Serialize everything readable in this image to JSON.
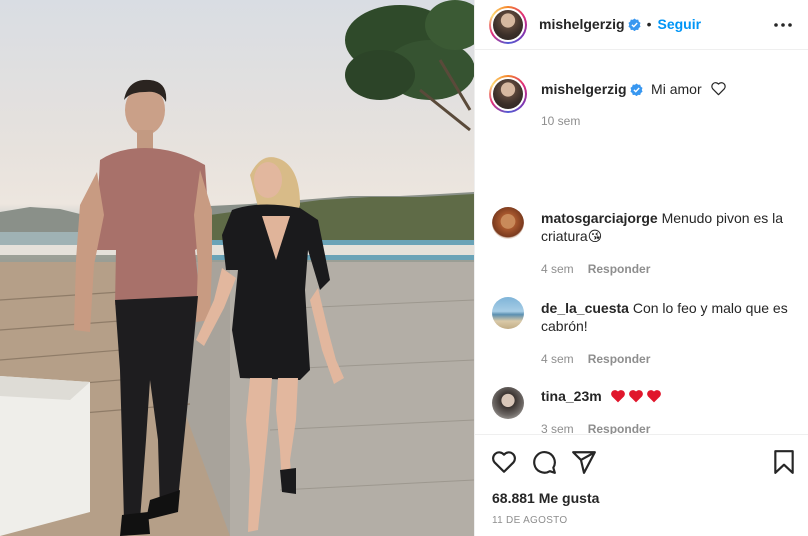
{
  "post": {
    "author": "mishelgerzig",
    "follow_label": "Seguir",
    "separator": "•",
    "caption": "Mi amor",
    "caption_age": "10 sem",
    "likes": "68.881 Me gusta",
    "date": "11 de agosto"
  },
  "comments": [
    {
      "user": "matosgarciajorge",
      "text": "Menudo pivon es la criatura😘",
      "age": "4 sem",
      "reply": "Responder"
    },
    {
      "user": "de_la_cuesta",
      "text": "Con lo feo y malo que es cabrón!",
      "age": "4 sem",
      "reply": "Responder"
    },
    {
      "user": "tina_23m",
      "text": "",
      "age": "3 sem",
      "reply": "Responder"
    }
  ],
  "icons": {
    "verified": "verified-badge-icon",
    "more": "more-options-icon",
    "like": "heart-icon",
    "comment": "comment-icon",
    "share": "share-icon",
    "save": "bookmark-icon"
  },
  "colors": {
    "accent": "#0095f6",
    "heart_red": "#ed4956",
    "muted": "#8e8e8e"
  }
}
